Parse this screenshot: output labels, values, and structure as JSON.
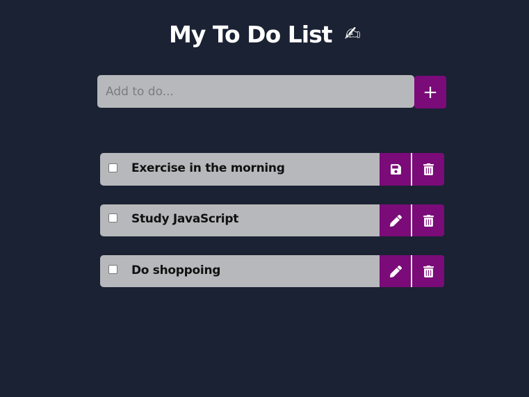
{
  "title": "My To Do List",
  "title_emoji": "✍",
  "add": {
    "placeholder": "Add to do...",
    "button_label": "+"
  },
  "todos": [
    {
      "text": "Exercise in the morning",
      "checked": false,
      "edit_icon": "save-icon",
      "delete_icon": "trash-icon"
    },
    {
      "text": "Study JavaScript",
      "checked": false,
      "edit_icon": "pencil-icon",
      "delete_icon": "trash-icon"
    },
    {
      "text": "Do shoppoing",
      "checked": false,
      "edit_icon": "pencil-icon",
      "delete_icon": "trash-icon"
    }
  ],
  "colors": {
    "background": "#1a2233",
    "accent": "#7a0b78",
    "item_bg": "#b7b8bb",
    "title_color": "#ffffff"
  }
}
